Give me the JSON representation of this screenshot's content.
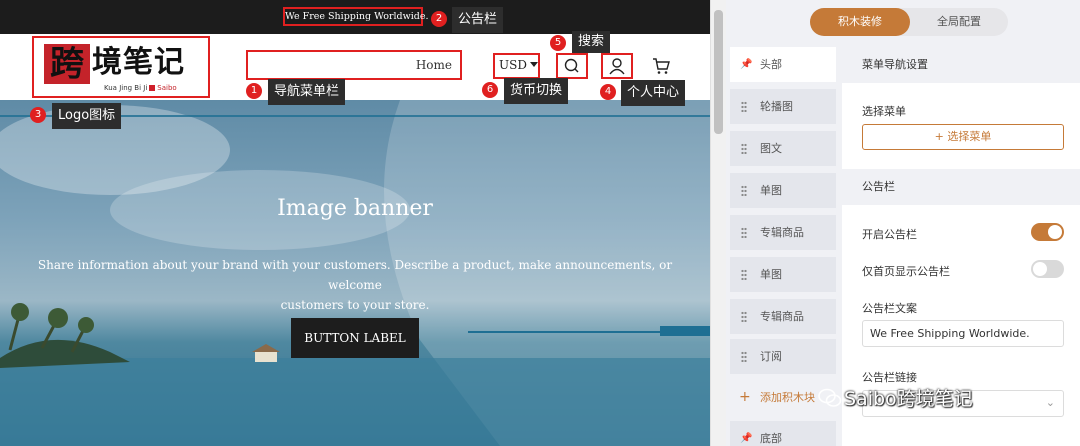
{
  "announcement": {
    "text": "We Free Shipping Worldwide."
  },
  "logo": {
    "mark": "跨",
    "chars": "境笔记",
    "sub": "Kua Jing Bi Ji",
    "sub_brand": "Saibo"
  },
  "nav": {
    "home": "Home"
  },
  "currency": {
    "value": "USD"
  },
  "annotations": [
    {
      "num": "1",
      "label": "导航菜单栏"
    },
    {
      "num": "2",
      "label": "公告栏"
    },
    {
      "num": "3",
      "label": "Logo图标"
    },
    {
      "num": "4",
      "label": "个人中心"
    },
    {
      "num": "5",
      "label": "搜索"
    },
    {
      "num": "6",
      "label": "货币切换"
    }
  ],
  "banner": {
    "title": "Image banner",
    "desc_line1": "Share information about your brand with your customers. Describe a product, make announcements, or welcome",
    "desc_line2": "customers to your store.",
    "button": "BUTTON LABEL"
  },
  "panel": {
    "tabs": [
      "积木装修",
      "全局配置"
    ],
    "active_tab": "积木装修",
    "blocks": [
      "头部",
      "轮播图",
      "图文",
      "单图",
      "专辑商品",
      "单图",
      "专辑商品",
      "订阅"
    ],
    "add_block": "添加积木块",
    "footer": "底部",
    "sections": {
      "menu_nav": "菜单导航设置",
      "choose_menu_label": "选择菜单",
      "choose_menu_button": "+ 选择菜单",
      "announcement": "公告栏",
      "enable_label": "开启公告栏",
      "enable_on": true,
      "home_only_label": "仅首页显示公告栏",
      "home_only_on": false,
      "text_label": "公告栏文案",
      "text_value": "We Free Shipping Worldwide.",
      "link_label": "公告栏链接"
    }
  },
  "watermark": "Saibo跨境笔记",
  "colors": {
    "accent": "#c57a38",
    "annotation_red": "#e02020",
    "tag_dark": "#2d2d2d"
  }
}
